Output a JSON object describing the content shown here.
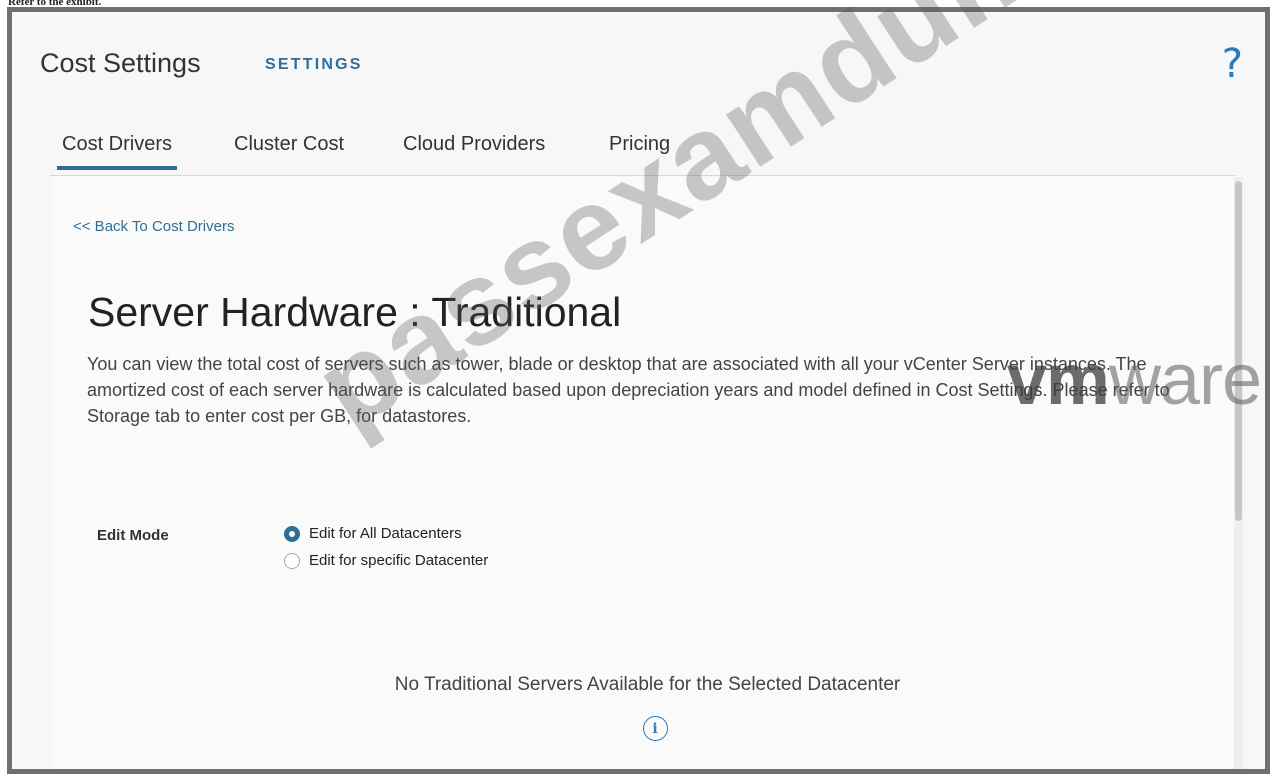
{
  "caption": "Refer to the exhibit.",
  "app": {
    "title": "Cost Settings",
    "subtitle": "SETTINGS",
    "help_icon": "question-mark-icon"
  },
  "tabs": [
    {
      "label": "Cost Drivers",
      "active": true
    },
    {
      "label": "Cluster Cost",
      "active": false
    },
    {
      "label": "Cloud Providers",
      "active": false
    },
    {
      "label": "Pricing",
      "active": false
    }
  ],
  "back_link": "<< Back To Cost Drivers",
  "page_title": "Server Hardware : Traditional",
  "description": "You can view the total cost of servers such as tower, blade or desktop that are associated with all your vCenter Server instances. The amortized cost of each server hardware is calculated based upon depreciation years and model defined in Cost Settings. Please refer to Storage tab to enter cost per GB, for datastores.",
  "edit_mode": {
    "label": "Edit Mode",
    "options": [
      {
        "label": "Edit for All Datacenters",
        "selected": true
      },
      {
        "label": "Edit for specific Datacenter",
        "selected": false
      }
    ]
  },
  "empty_state": {
    "message": "No Traditional Servers Available for the Selected Datacenter",
    "icon": "info-icon"
  },
  "watermark": {
    "text": "passexamdumps.com",
    "logo_bold": "vm",
    "logo_rest": "ware"
  },
  "colors": {
    "accent": "#2f6f96",
    "frame_border": "#6b7178"
  }
}
